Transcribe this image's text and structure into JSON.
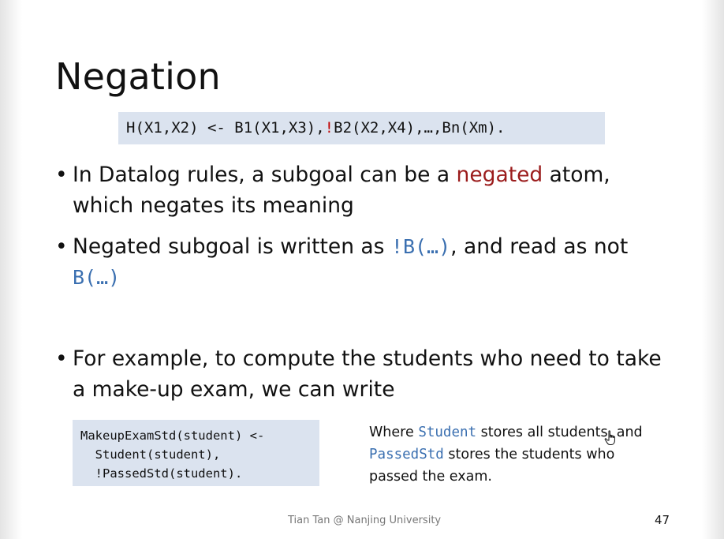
{
  "slide": {
    "title": "Negation",
    "formula": {
      "before": "H(X1,X2) <- B1(X1,X3),",
      "bang": "!",
      "after": "B2(X2,X4),…,Bn(Xm)."
    },
    "bullet_char": "•",
    "bullets": [
      {
        "pre": "In Datalog rules, a subgoal can be a ",
        "highlight": "negated",
        "post": " atom, which negates its meaning"
      },
      {
        "pre": "Negated subgoal is written as ",
        "code1": "!B(…)",
        "mid": ", and read as not ",
        "code2": "B(…)"
      },
      {
        "text": "For example, to compute the students who need to take a make-up exam, we can write"
      }
    ],
    "code_lines": [
      "MakeupExamStd(student) <-",
      "  Student(student),",
      "  !PassedStd(student)."
    ],
    "note": {
      "t1": "Where ",
      "c1": "Student",
      "t2": " stores all students, and ",
      "c2": "PassedStd",
      "t3": " stores the students who passed the exam."
    },
    "footer": "Tian Tan @ Nanjing University",
    "page_number": "47"
  },
  "colors": {
    "negated_red": "#9b1c1c",
    "bang_red": "#c00000",
    "code_blue": "#3a6fb0",
    "code_box_bg": "#dbe3ef"
  },
  "icons": {
    "cursor": "hand-pointer-icon"
  }
}
